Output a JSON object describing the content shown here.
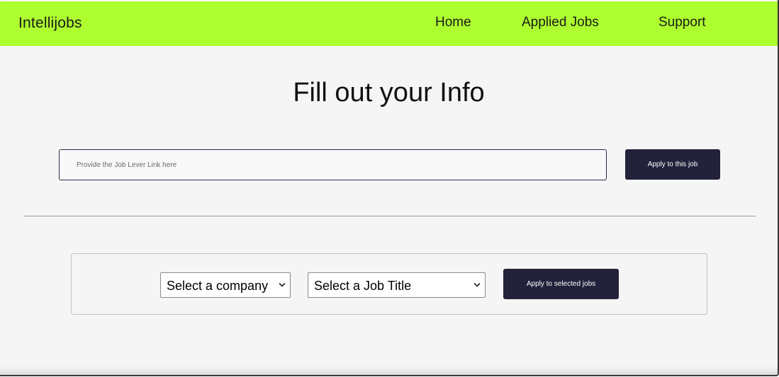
{
  "navbar": {
    "brand": "Intellijobs",
    "links": [
      "Home",
      "Applied Jobs",
      "Support"
    ],
    "background": "#adff2f"
  },
  "main": {
    "title": "Fill out your Info",
    "link_input": {
      "placeholder": "Provide the Job Lever Link here",
      "value": ""
    },
    "apply_button_label": "Apply to this job"
  },
  "selection_panel": {
    "company_select": {
      "selected": "Select a company",
      "icon": "chevron-down-icon"
    },
    "job_title_select": {
      "selected": "Select a Job Title",
      "icon": "chevron-down-icon"
    },
    "apply_selected_label": "Apply to selected jobs"
  },
  "colors": {
    "accent": "#adff2f",
    "button": "#22223b",
    "page_background": "#f5f5f5"
  }
}
